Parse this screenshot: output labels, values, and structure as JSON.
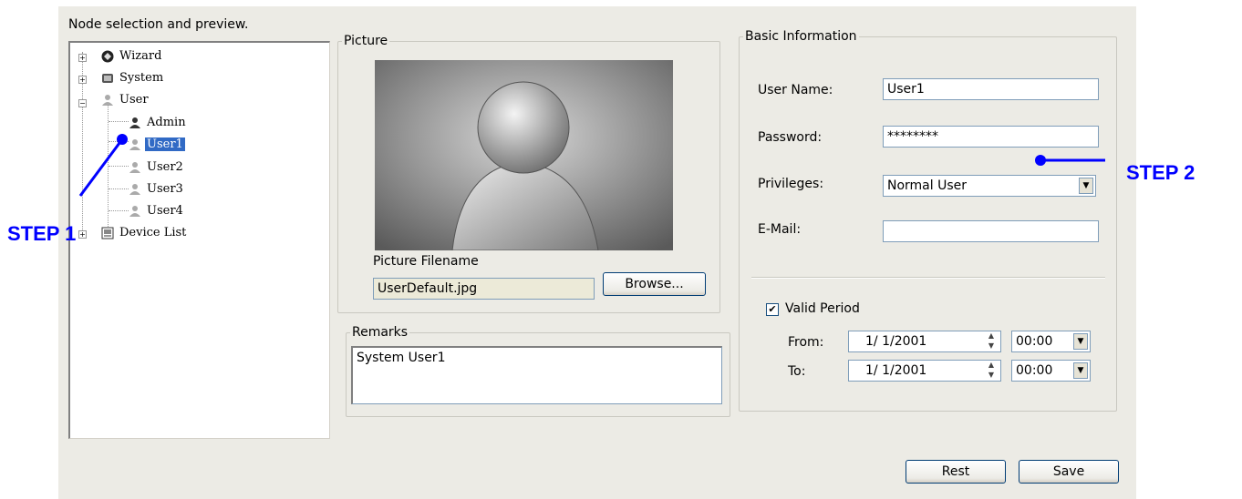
{
  "tree": {
    "title": "Node selection and preview.",
    "items": [
      {
        "label": "Wizard",
        "icon": "wizard-icon"
      },
      {
        "label": "System",
        "icon": "system-icon"
      },
      {
        "label": "User",
        "icon": "user-group-icon"
      },
      {
        "label": "Admin",
        "icon": "admin-user-icon"
      },
      {
        "label": "User1",
        "icon": "user-icon"
      },
      {
        "label": "User2",
        "icon": "user-icon"
      },
      {
        "label": "User3",
        "icon": "user-icon"
      },
      {
        "label": "User4",
        "icon": "user-icon"
      },
      {
        "label": "Device List",
        "icon": "device-list-icon"
      }
    ]
  },
  "picture": {
    "legend": "Picture",
    "filename_label": "Picture Filename",
    "filename_value": "UserDefault.jpg",
    "browse_label": "Browse..."
  },
  "remarks": {
    "legend": "Remarks",
    "value": "System User1"
  },
  "basic": {
    "legend": "Basic Information",
    "user_name_label": "User Name:",
    "user_name_value": "User1",
    "password_label": "Password:",
    "password_value": "********",
    "privileges_label": "Privileges:",
    "privileges_value": "Normal User",
    "email_label": "E-Mail:",
    "email_value": "",
    "valid_period_label": "Valid Period",
    "valid_period_checked": true,
    "from_label": "From:",
    "from_date": "1/ 1/2001",
    "from_time": "00:00",
    "to_label": "To:",
    "to_date": "1/ 1/2001",
    "to_time": "00:00"
  },
  "buttons": {
    "rest_label": "Rest",
    "save_label": "Save"
  },
  "annotations": {
    "step1": "STEP 1",
    "step2": "STEP 2",
    "color": "#0000ff"
  },
  "colors": {
    "panel_bg": "#ecebe5",
    "selection": "#316ac5"
  }
}
